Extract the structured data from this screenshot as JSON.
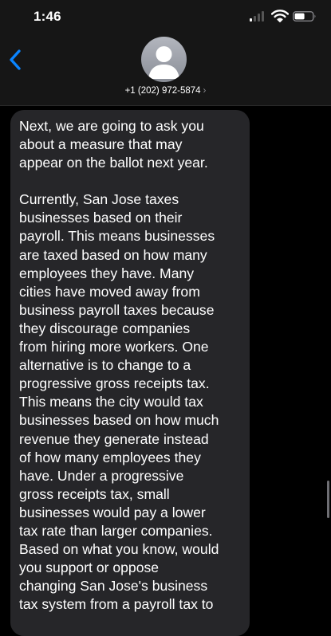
{
  "status_bar": {
    "time": "1:46",
    "icons": [
      "signal-icon",
      "wifi-icon",
      "battery-icon"
    ]
  },
  "header": {
    "back_icon": "chevron-left-icon",
    "avatar_icon": "person-icon",
    "contact": "+1 (202) 972-5874",
    "contact_chevron": "›",
    "accent_color": "#0a84ff"
  },
  "message": {
    "paragraphs": [
      "Next, we are going to ask you\nabout a measure that may\nappear on the ballot next year.",
      "Currently, San Jose taxes\nbusinesses based on their\npayroll. This means businesses\nare taxed based on how many\nemployees they have. Many\ncities have moved away from\nbusiness payroll taxes because\nthey discourage companies\nfrom hiring more workers. One\nalternative is to change to a\nprogressive gross receipts tax.\nThis means the city would tax\nbusinesses based on how much\nrevenue they generate instead\nof how many employees they\nhave. Under a progressive\ngross receipts tax, small\nbusinesses would pay a lower\ntax rate than larger companies.\nBased on what you know, would\nyou support or oppose\nchanging San Jose's business\ntax system from a payroll tax to"
    ],
    "bubble_color": "#262629"
  }
}
